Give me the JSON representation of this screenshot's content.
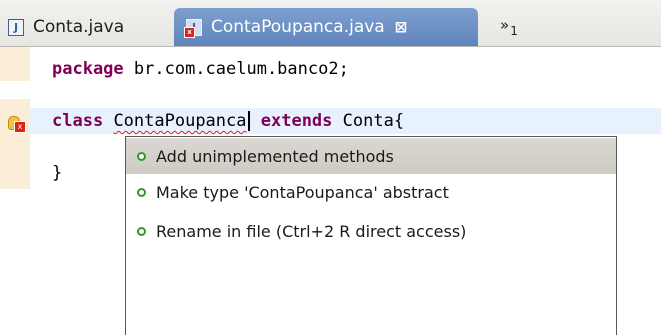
{
  "tabs": {
    "conta": {
      "label": "Conta.java",
      "icon": "java-file-icon"
    },
    "active": {
      "label": "ContaPoupanca.java",
      "icon": "java-file-error-icon",
      "close": "close-icon"
    },
    "overflow": {
      "symbol": "»",
      "count": "1"
    }
  },
  "editor": {
    "line1": {
      "keyword": "package",
      "rest": " br.com.caelum.banco2;"
    },
    "line2": {
      "keyword1": "class",
      "space1": " ",
      "classname": "ContaPoupanca",
      "space2": " ",
      "keyword2": "extends",
      "rest": " Conta{"
    },
    "line3": {
      "text": "}"
    }
  },
  "quickfix": {
    "items": [
      {
        "label": "Add unimplemented methods",
        "selected": true
      },
      {
        "label": "Make type 'ContaPoupanca' abstract",
        "selected": false
      },
      {
        "label": "Rename in file (Ctrl+2 R direct access)",
        "selected": false
      }
    ]
  },
  "colors": {
    "keyword": "#7f0055",
    "active_tab": "#6f93c8",
    "error": "#d8241b",
    "current_line": "#e8f2fe",
    "selection": "#d4d1cb"
  }
}
